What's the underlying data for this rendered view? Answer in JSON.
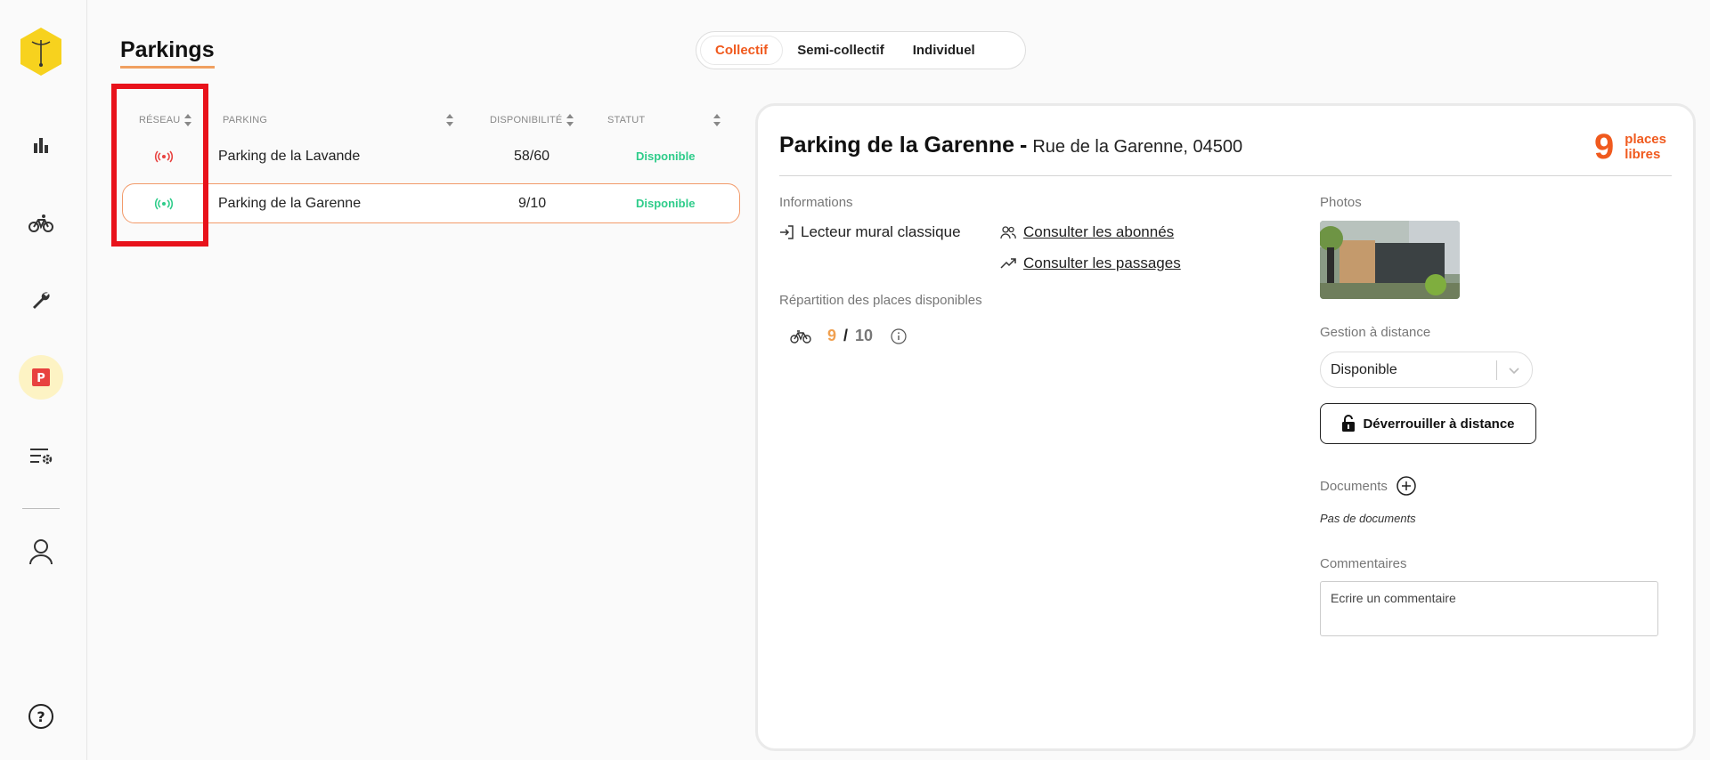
{
  "header": {
    "title": "Parkings",
    "tabs": [
      {
        "label": "Collectif",
        "active": true
      },
      {
        "label": "Semi-collectif",
        "active": false
      },
      {
        "label": "Individuel",
        "active": false
      }
    ]
  },
  "sidebar": {
    "items": [
      "logo-icon",
      "stats-icon",
      "bike-icon",
      "wrench-icon",
      "parking-icon",
      "settings-list-icon",
      "user-icon",
      "help-icon"
    ],
    "active": "parking-icon"
  },
  "table": {
    "columns": {
      "network": "RÉSEAU",
      "parking": "PARKING",
      "availability": "DISPONIBILITÉ",
      "status": "STATUT"
    },
    "rows": [
      {
        "network_status": "offline",
        "network_color": "#e8423f",
        "parking": "Parking de la Lavande",
        "availability": "58/60",
        "status": "Disponible",
        "selected": false
      },
      {
        "network_status": "online",
        "network_color": "#2ecc8a",
        "parking": "Parking de la Garenne",
        "availability": "9/10",
        "status": "Disponible",
        "selected": true
      }
    ]
  },
  "detail": {
    "name": "Parking de la Garenne",
    "separator": "-",
    "address": "Rue de la Garenne, 04500",
    "free_count": "9",
    "free_label_1": "places",
    "free_label_2": "libres",
    "informations_label": "Informations",
    "reader": "Lecteur mural classique",
    "subscribers_link": "Consulter les abonnés",
    "passages_link": "Consulter les passages",
    "distribution_label": "Répartition des places disponibles",
    "bike_available": "9",
    "bike_slash": "/",
    "bike_total": "10",
    "photos_label": "Photos",
    "remote_label": "Gestion à distance",
    "remote_value": "Disponible",
    "unlock_label": "Déverrouiller à distance",
    "documents_label": "Documents",
    "no_documents": "Pas de documents",
    "comments_label": "Commentaires",
    "comment_placeholder": "Ecrire un commentaire"
  },
  "colors": {
    "accent": "#f05a1e",
    "available": "#2ecc8a",
    "offline": "#e8423f",
    "logo": "#f7d21e"
  }
}
